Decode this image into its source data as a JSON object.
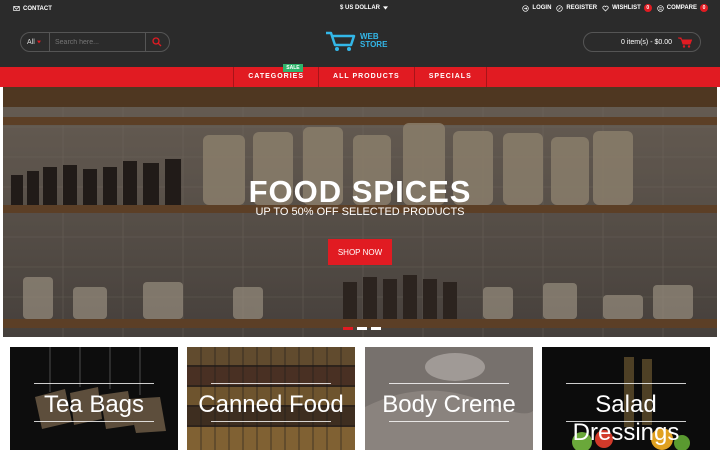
{
  "topbar": {
    "contact": "CONTACT",
    "currency": "$ US DOLLAR",
    "login": "LOGIN",
    "register": "REGISTER",
    "wishlist": "WISHLIST",
    "wishlist_count": "0",
    "compare": "COMPARE",
    "compare_count": "0"
  },
  "header": {
    "search_category": "All",
    "search_placeholder": "Search here...",
    "logo_line1": "WEB",
    "logo_line2": "STORE",
    "cart_summary": "0 item(s) - $0.00"
  },
  "nav": {
    "items": [
      "CATEGORIES",
      "ALL PRODUCTS",
      "SPECIALS"
    ],
    "sale_badge": "SALE"
  },
  "hero": {
    "title": "FOOD SPICES",
    "subtitle": "UP TO 50% OFF SELECTED PRODUCTS",
    "button": "SHOP NOW",
    "active_slide": 1,
    "slide_count": 3
  },
  "categories": [
    {
      "name": "Tea Bags"
    },
    {
      "name": "Canned Food"
    },
    {
      "name": "Body Creme"
    },
    {
      "name": "Salad Dressings"
    }
  ],
  "colors": {
    "accent": "#e11b22",
    "dark": "#2b2b2b",
    "logo": "#33b7e8",
    "sale": "#2fb36b"
  }
}
